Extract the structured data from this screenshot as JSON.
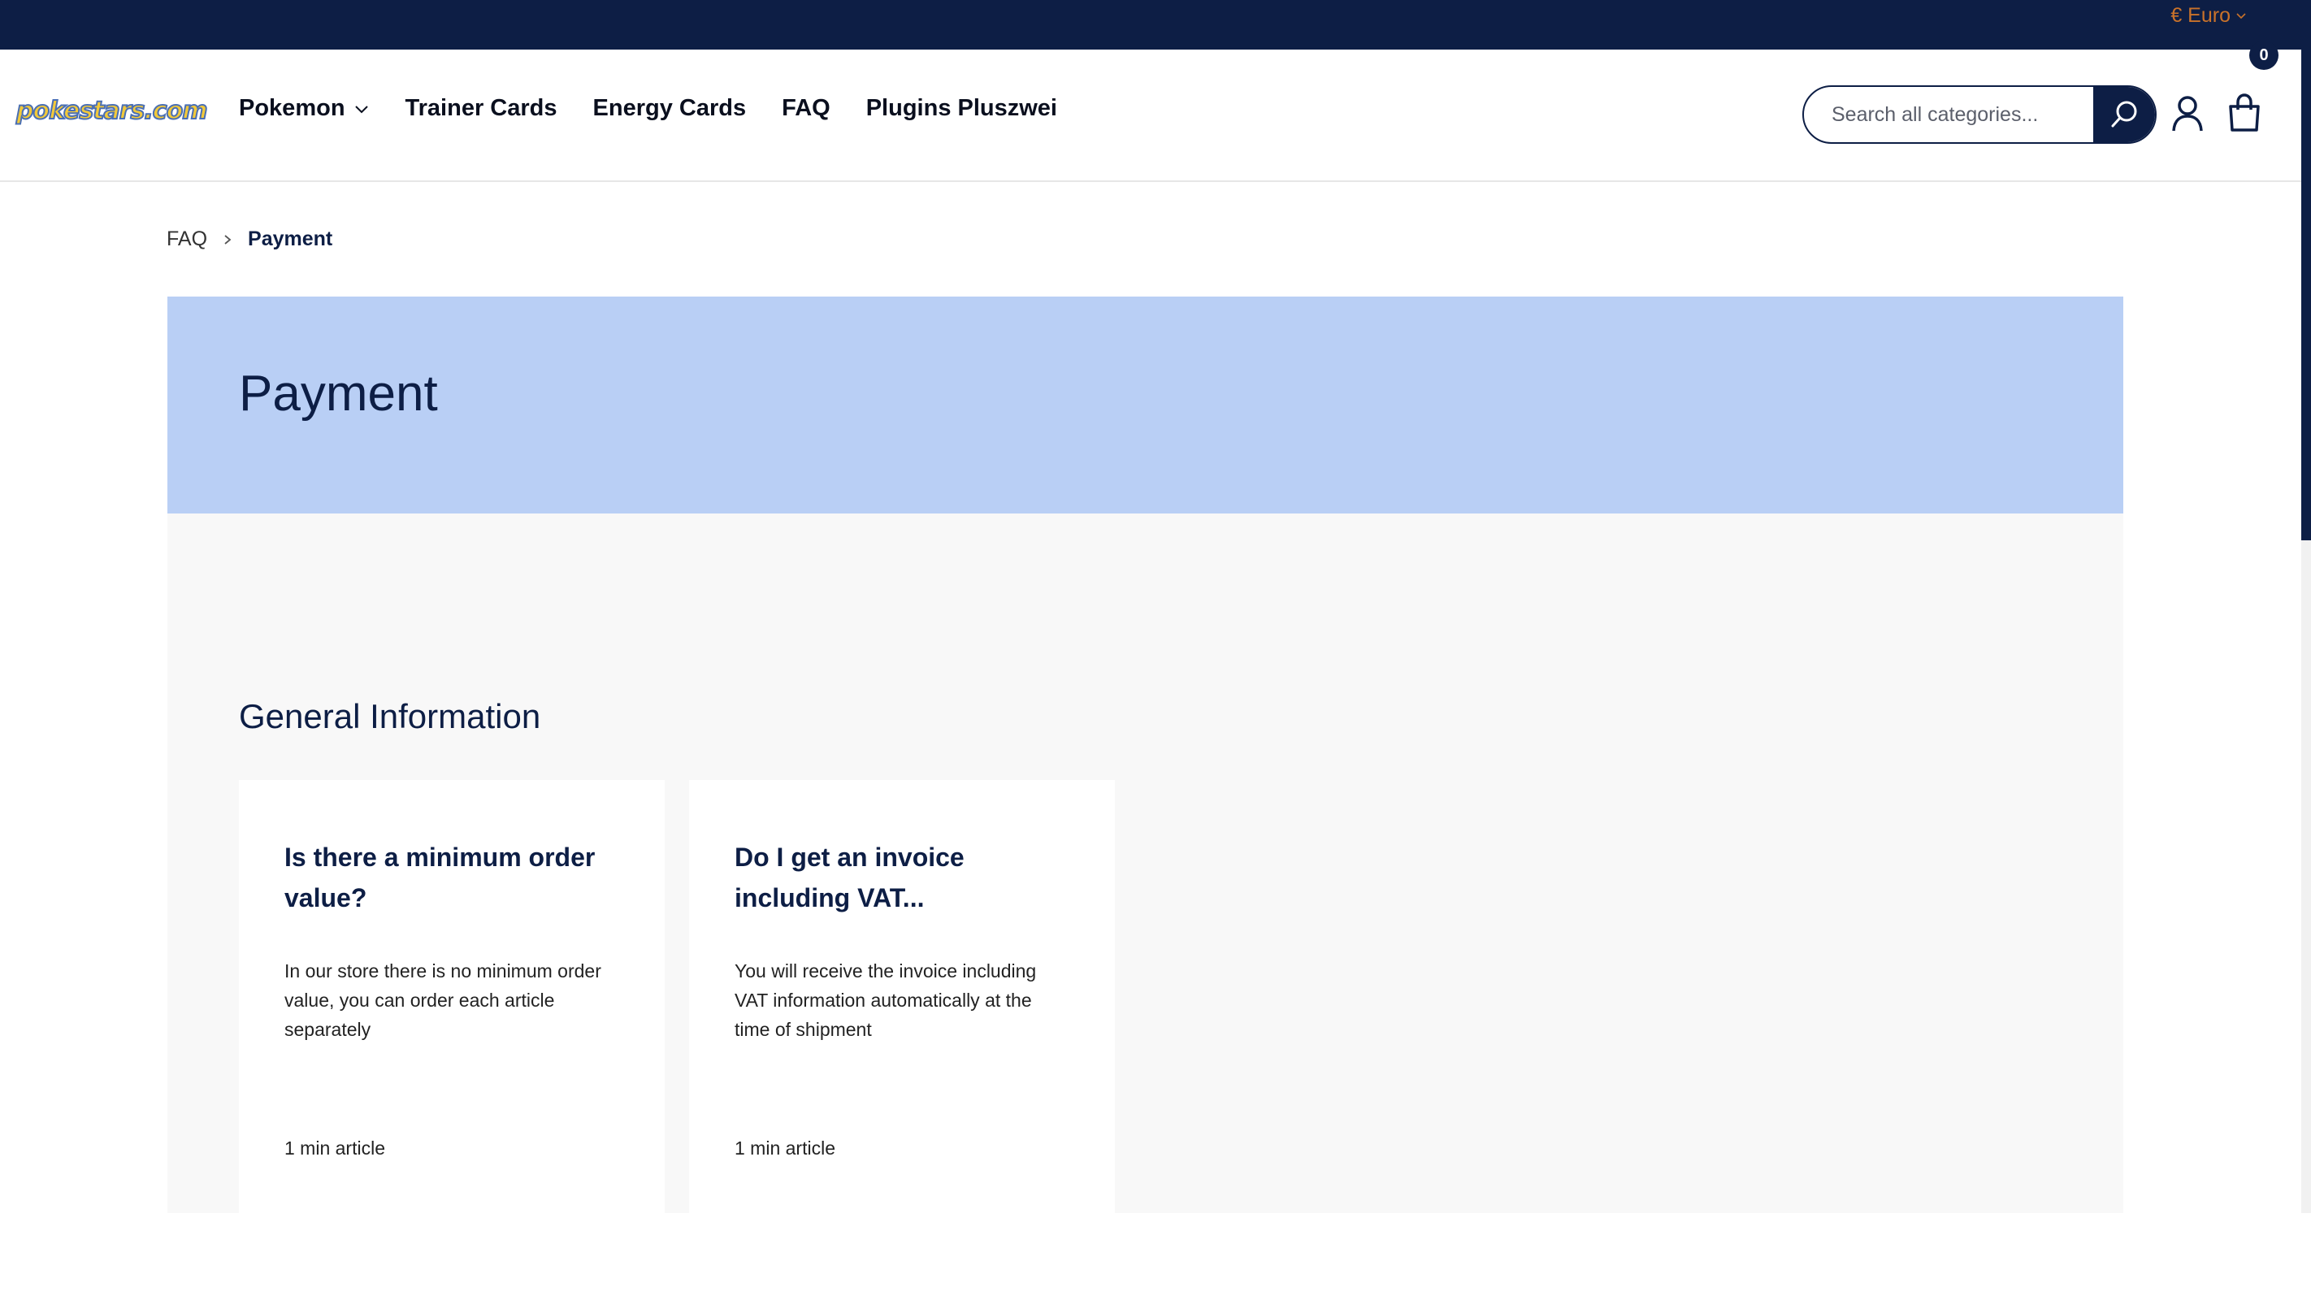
{
  "topbar": {
    "currency_label": "€ Euro",
    "currency_chevron_icon": "chevron-down-icon",
    "accent_color": "#c9722a",
    "background_color": "#0d1e45"
  },
  "header": {
    "logo_text": "pokestars.com",
    "nav": [
      {
        "label": "Pokemon",
        "has_dropdown": true
      },
      {
        "label": "Trainer Cards"
      },
      {
        "label": "Energy Cards"
      },
      {
        "label": "FAQ"
      },
      {
        "label": "Plugins Pluszwei"
      }
    ],
    "search": {
      "placeholder": "Search all categories...",
      "value": "",
      "button_icon": "search-icon"
    },
    "account_icon": "user-icon",
    "cart_icon": "shopping-bag-icon",
    "cart_count": "0"
  },
  "breadcrumb": {
    "items": [
      "FAQ"
    ],
    "current": "Payment"
  },
  "hero": {
    "title": "Payment",
    "background_color": "#b9cff5"
  },
  "section": {
    "title": "General Information",
    "cards": [
      {
        "title": "Is there a minimum order value?",
        "text": "In our store there is no minimum order value, you can order each article separately",
        "meta": "1 min article"
      },
      {
        "title": "Do I get an invoice including VAT...",
        "text": "You will receive the invoice including VAT information automatically at the time of shipment",
        "meta": "1 min article"
      }
    ]
  }
}
